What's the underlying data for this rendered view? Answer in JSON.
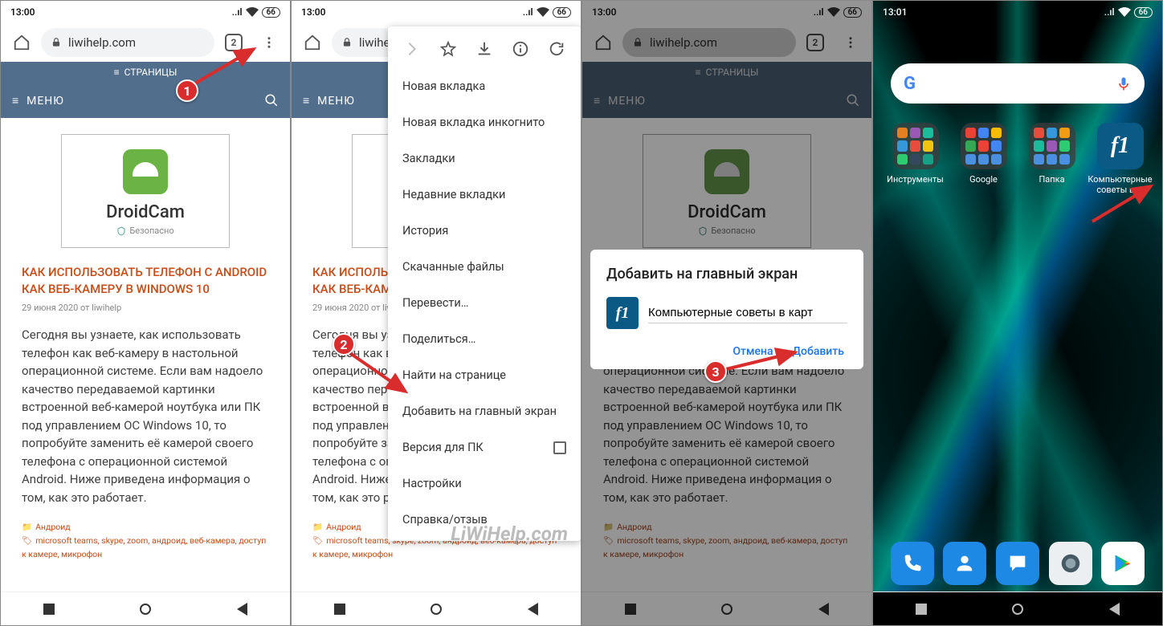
{
  "status": {
    "time": "13:00",
    "time4": "13:01",
    "battery": "66"
  },
  "browser": {
    "url": "liwihelp.com",
    "tab_count": "2"
  },
  "page": {
    "pages_label": "СТРАНИЦЫ",
    "menu_label": "МЕНЮ",
    "brand": "DroidCam",
    "safe_text": "Безопасно",
    "article_title": "КАК ИСПОЛЬЗОВАТЬ ТЕЛЕФОН С ANDROID КАК ВЕБ-КАМЕРУ В WINDOWS 10",
    "article_meta": "29 июня 2020 от liwihelp",
    "article_body": "Сегодня вы узнаете, как использовать телефон как веб-камеру в настольной операционной системе. Если вам надоело качество передаваемой картинки встроенной веб-камерой ноутбука или ПК под управлением ОС Windows 10, то попробуйте заменить её камерой своего телефона с операционной системой Android. Ниже приведена информация о том, как это работает.",
    "category": "Андроид",
    "tags_line": "microsoft teams, skype, zoom, андроид, веб-камера, доступ к камере, микрофон"
  },
  "chrome_menu": {
    "items": [
      "Новая вкладка",
      "Новая вкладка инкогнито",
      "Закладки",
      "Недавние вкладки",
      "История",
      "Скачанные файлы",
      "Перевести…",
      "Поделиться…",
      "Найти на странице",
      "Добавить на главный экран",
      "Версия для ПК",
      "Настройки",
      "Справка/отзыв"
    ]
  },
  "dialog": {
    "title": "Добавить на главный экран",
    "input_value": "Компьютерные советы в карт",
    "cancel": "Отмена",
    "add": "Добавить"
  },
  "home": {
    "folders": [
      "Инструменты",
      "Google",
      "Папка"
    ],
    "shortcut_label": "Компьютерные советы в ..."
  },
  "steps": {
    "s1": "1",
    "s2": "2",
    "s3": "3"
  },
  "watermark": "LiWiHelp.com"
}
